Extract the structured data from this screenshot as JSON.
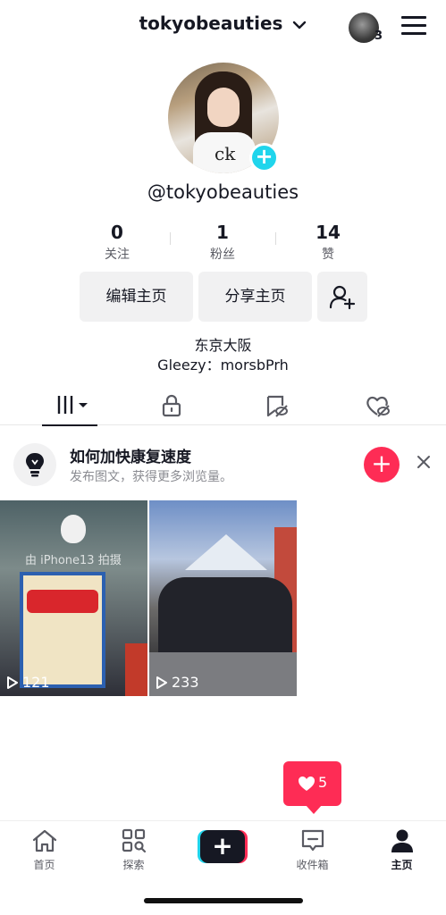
{
  "header": {
    "username": "tokyobeauties",
    "account_badge_count": "3"
  },
  "profile": {
    "handle": "@tokyobeauties",
    "stats": [
      {
        "value": "0",
        "label": "关注"
      },
      {
        "value": "1",
        "label": "粉丝"
      },
      {
        "value": "14",
        "label": "赞"
      }
    ],
    "edit_label": "编辑主页",
    "share_label": "分享主页",
    "bio_line1": "东京大阪",
    "bio_line2": "Gleezy：morsbPrh"
  },
  "tip": {
    "title": "如何加快康复速度",
    "subtitle": "发布图文，获得更多浏览量。"
  },
  "videos": [
    {
      "views": "121",
      "watermark": "由 iPhone13 拍摄"
    },
    {
      "views": "233"
    }
  ],
  "likes_popup": {
    "count": "5"
  },
  "bottom_nav": {
    "home": "首页",
    "discover": "探索",
    "inbox": "收件箱",
    "profile": "主页"
  },
  "colors": {
    "accent": "#fe2c55",
    "teal": "#20d5ec",
    "text": "#161823"
  }
}
